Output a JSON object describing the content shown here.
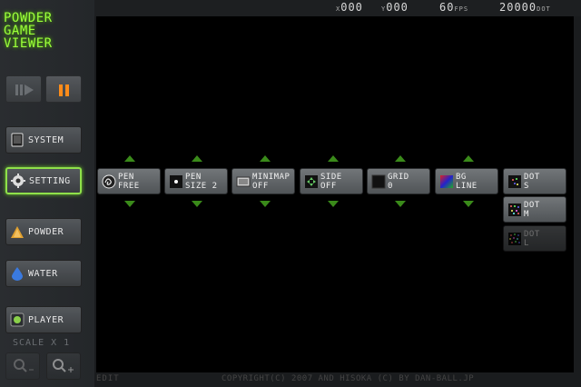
{
  "logo": {
    "line1": "POWDER",
    "line2": "GAME",
    "line3": "VIEWER"
  },
  "topbar": {
    "x_label": "X",
    "x_value": "000",
    "y_label": "Y",
    "y_value": "000",
    "fps_value": "60",
    "fps_unit": "FPS",
    "dot_value": "20000",
    "dot_unit": "DOT"
  },
  "sidebar": {
    "system": "SYSTEM",
    "setting": "SETTING",
    "powder": "POWDER",
    "water": "WATER",
    "player": "PLAYER",
    "scale": "SCALE X 1"
  },
  "tiles": [
    {
      "l1": "PEN",
      "l2": "FREE"
    },
    {
      "l1": "PEN",
      "l2": "SIZE 2"
    },
    {
      "l1": "MINIMAP",
      "l2": "OFF"
    },
    {
      "l1": "SIDE",
      "l2": "OFF"
    },
    {
      "l1": "GRID",
      "l2": "0"
    },
    {
      "l1": "BG",
      "l2": "LINE"
    },
    {
      "l1": "DOT",
      "l2": "S"
    },
    {
      "l1": "DOT",
      "l2": "M"
    },
    {
      "l1": "DOT",
      "l2": "L"
    }
  ],
  "bottom": {
    "edit": "EDIT",
    "copyright": "COPYRIGHT(C) 2007 AND HISOKA (C) BY DAN-BALL.JP"
  },
  "colors": {
    "accent_green": "#9bff3a",
    "pause_orange": "#ff8c1a",
    "canvas": "#000000"
  }
}
